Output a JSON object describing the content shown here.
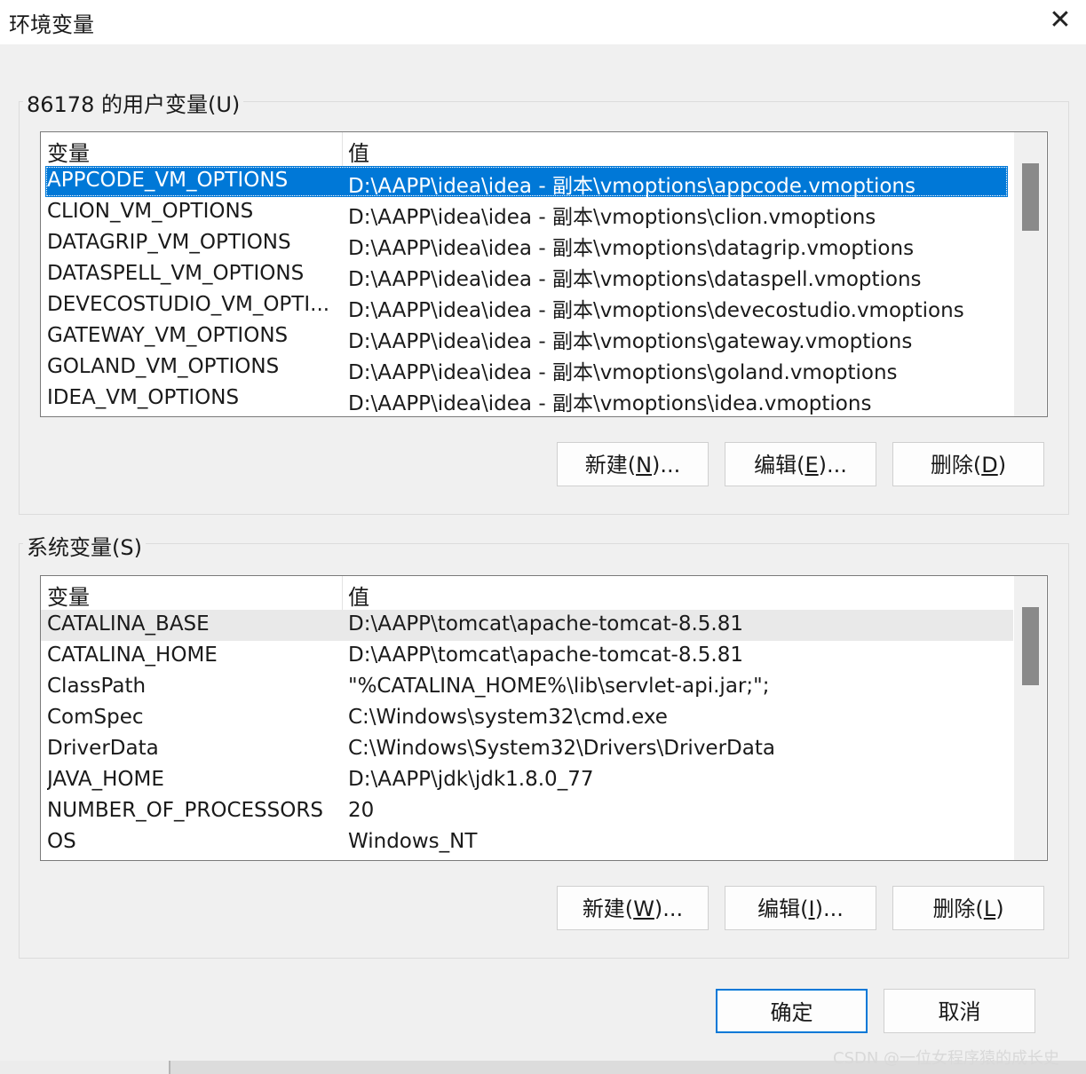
{
  "window": {
    "title": "环境变量",
    "close_glyph": "✕"
  },
  "user_vars": {
    "legend": "86178 的用户变量(U)",
    "columns": [
      "变量",
      "值"
    ],
    "rows": [
      {
        "name": "APPCODE_VM_OPTIONS",
        "value": "D:\\AAPP\\idea\\idea - 副本\\vmoptions\\appcode.vmoptions"
      },
      {
        "name": "CLION_VM_OPTIONS",
        "value": "D:\\AAPP\\idea\\idea - 副本\\vmoptions\\clion.vmoptions"
      },
      {
        "name": "DATAGRIP_VM_OPTIONS",
        "value": "D:\\AAPP\\idea\\idea - 副本\\vmoptions\\datagrip.vmoptions"
      },
      {
        "name": "DATASPELL_VM_OPTIONS",
        "value": "D:\\AAPP\\idea\\idea - 副本\\vmoptions\\dataspell.vmoptions"
      },
      {
        "name": "DEVECOSTUDIO_VM_OPTI...",
        "value": "D:\\AAPP\\idea\\idea - 副本\\vmoptions\\devecostudio.vmoptions"
      },
      {
        "name": "GATEWAY_VM_OPTIONS",
        "value": "D:\\AAPP\\idea\\idea - 副本\\vmoptions\\gateway.vmoptions"
      },
      {
        "name": "GOLAND_VM_OPTIONS",
        "value": "D:\\AAPP\\idea\\idea - 副本\\vmoptions\\goland.vmoptions"
      },
      {
        "name": "IDEA_VM_OPTIONS",
        "value": "D:\\AAPP\\idea\\idea - 副本\\vmoptions\\idea.vmoptions"
      }
    ],
    "buttons": {
      "new_pre": "新建(",
      "new_key": "N",
      "new_post": ")...",
      "edit_pre": "编辑(",
      "edit_key": "E",
      "edit_post": ")...",
      "delete_pre": "删除(",
      "delete_key": "D",
      "delete_post": ")"
    }
  },
  "system_vars": {
    "legend": "系统变量(S)",
    "columns": [
      "变量",
      "值"
    ],
    "rows": [
      {
        "name": "CATALINA_BASE",
        "value": "D:\\AAPP\\tomcat\\apache-tomcat-8.5.81"
      },
      {
        "name": "CATALINA_HOME",
        "value": "D:\\AAPP\\tomcat\\apache-tomcat-8.5.81"
      },
      {
        "name": "ClassPath",
        "value": "\"%CATALINA_HOME%\\lib\\servlet-api.jar;\";"
      },
      {
        "name": "ComSpec",
        "value": "C:\\Windows\\system32\\cmd.exe"
      },
      {
        "name": "DriverData",
        "value": "C:\\Windows\\System32\\Drivers\\DriverData"
      },
      {
        "name": "JAVA_HOME",
        "value": "D:\\AAPP\\jdk\\jdk1.8.0_77"
      },
      {
        "name": "NUMBER_OF_PROCESSORS",
        "value": "20"
      },
      {
        "name": "OS",
        "value": "Windows_NT"
      }
    ],
    "buttons": {
      "new_pre": "新建(",
      "new_key": "W",
      "new_post": ")...",
      "edit_pre": "编辑(",
      "edit_key": "I",
      "edit_post": ")...",
      "delete_pre": "删除(",
      "delete_key": "L",
      "delete_post": ")"
    }
  },
  "dialog_buttons": {
    "ok": "确定",
    "cancel": "取消"
  },
  "watermark": "CSDN @一位女程序猿的成长史",
  "colors": {
    "selection": "#0078d7",
    "dialog_bg": "#f0f0f0"
  }
}
